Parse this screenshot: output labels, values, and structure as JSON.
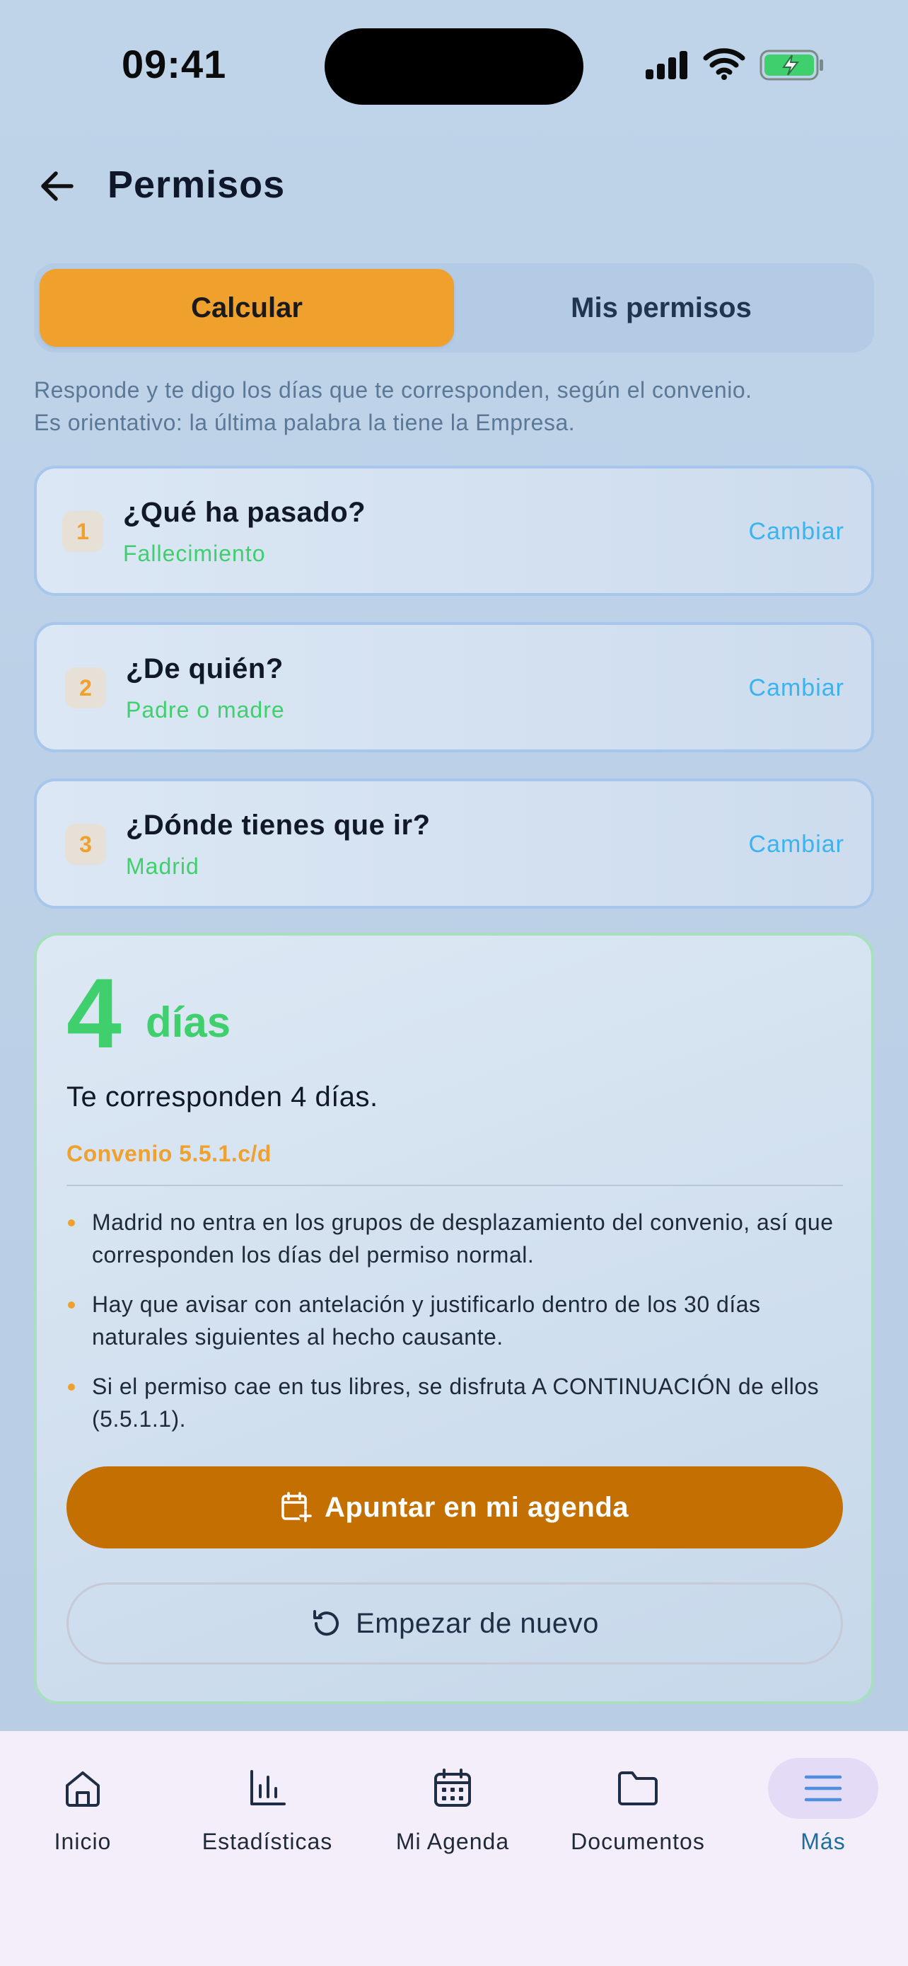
{
  "status_bar": {
    "time": "09:41"
  },
  "header": {
    "title": "Permisos"
  },
  "tabs": [
    {
      "label": "Calcular",
      "active": true
    },
    {
      "label": "Mis permisos",
      "active": false
    }
  ],
  "intro": {
    "line1": "Responde y te digo los días que te corresponden, según el convenio.",
    "line2": "Es orientativo: la última palabra la tiene la Empresa."
  },
  "questions": [
    {
      "number": "1",
      "title": "¿Qué ha pasado?",
      "answer": "Fallecimiento",
      "action": "Cambiar"
    },
    {
      "number": "2",
      "title": "¿De quién?",
      "answer": "Padre o madre",
      "action": "Cambiar"
    },
    {
      "number": "3",
      "title": "¿Dónde tienes que ir?",
      "answer": "Madrid",
      "action": "Cambiar"
    }
  ],
  "result": {
    "days": "4",
    "days_label": "días",
    "sentence": "Te corresponden 4 días.",
    "convenio": "Convenio 5.5.1.c/d",
    "notes": [
      "Madrid no entra en los grupos de desplazamiento del convenio, así que corresponden los días del permiso normal.",
      "Hay que avisar con antelación y justificarlo dentro de los 30 días naturales siguientes al hecho causante.",
      "Si el permiso cae en tus libres, se disfruta A CONTINUACIÓN de ellos (5.5.1.1)."
    ],
    "primary_button": "Apuntar en mi agenda",
    "secondary_button": "Empezar de nuevo"
  },
  "nav": [
    {
      "label": "Inicio",
      "icon": "home-icon",
      "active": false
    },
    {
      "label": "Estadísticas",
      "icon": "bar-chart-icon",
      "active": false
    },
    {
      "label": "Mi Agenda",
      "icon": "calendar-icon",
      "active": false
    },
    {
      "label": "Documentos",
      "icon": "folder-icon",
      "active": false
    },
    {
      "label": "Más",
      "icon": "menu-icon",
      "active": true
    }
  ],
  "colors": {
    "accent_orange": "#f0a02c",
    "success_green": "#3fcf6d",
    "link_blue": "#3ab4f0",
    "primary_button": "#c36f02",
    "nav_active": "#1e6d9b"
  }
}
